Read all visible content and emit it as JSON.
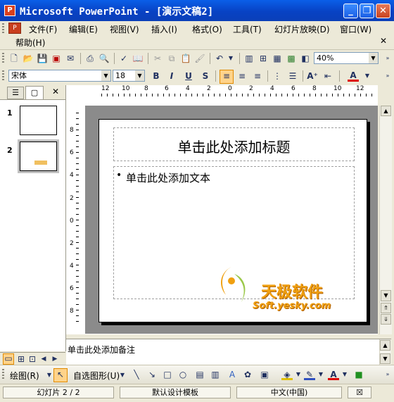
{
  "window": {
    "app": "Microsoft PowerPoint",
    "title": "Microsoft PowerPoint - [演示文稿2]",
    "controls": {
      "minimize": "_",
      "restore": "❐",
      "close": "✕"
    }
  },
  "menu": {
    "items": [
      "文件(F)",
      "编辑(E)",
      "视图(V)",
      "插入(I)",
      "格式(O)",
      "工具(T)",
      "幻灯片放映(D)",
      "窗口(W)"
    ],
    "help": "帮助(H)",
    "close_glyph": "✕"
  },
  "standard_toolbar": {
    "zoom": "40%"
  },
  "format_toolbar": {
    "font": "宋体",
    "size": "18",
    "bold": "B",
    "italic": "I",
    "underline": "U",
    "shadow": "S",
    "font_color_glyph": "A"
  },
  "outline_tabs": {
    "outline_glyph": "☰",
    "slides_glyph": "▢",
    "close_glyph": "✕"
  },
  "slides": [
    {
      "number": "1"
    },
    {
      "number": "2"
    }
  ],
  "ruler": {
    "h_labels": [
      "12",
      "10",
      "8",
      "6",
      "4",
      "2",
      "0",
      "2",
      "4",
      "6",
      "8",
      "10",
      "12"
    ],
    "v_labels": [
      "8",
      "6",
      "4",
      "2",
      "0",
      "2",
      "4",
      "6",
      "8"
    ]
  },
  "slide": {
    "title_placeholder": "单击此处添加标题",
    "body_placeholder": "单击此处添加文本",
    "bullet": "•"
  },
  "watermark": {
    "brand": "天极软件",
    "url": "Soft.yesky.com"
  },
  "notes": {
    "placeholder": "单击此处添加备注"
  },
  "draw_toolbar": {
    "draw": "绘图(R)",
    "autoshapes": "自选图形(U)"
  },
  "status": {
    "slide": "幻灯片 2 / 2",
    "design": "默认设计模板",
    "language": "中文(中国)"
  },
  "colors": {
    "titlebar": "#0A5FE8",
    "chrome": "#ECE9D8",
    "canvas": "#8B8B8B",
    "watermark": "#F0A010"
  }
}
